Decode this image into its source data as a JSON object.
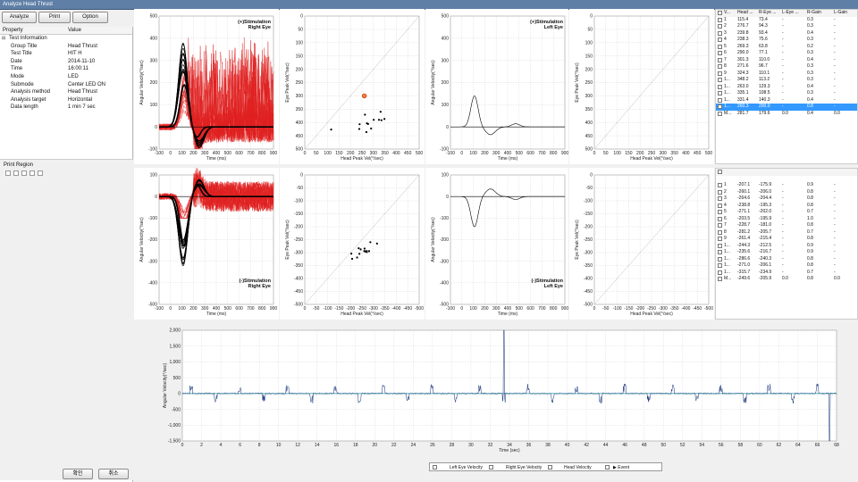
{
  "window": {
    "title": "Analyze Head Thrust"
  },
  "toolbar": {
    "analyze": "Analyze",
    "print": "Print",
    "option": "Option"
  },
  "properties": {
    "col_property": "Property",
    "col_value": "Value",
    "group_label": "Test Information",
    "group_toggle": "⊟",
    "rows": [
      {
        "name": "Group Title",
        "value": "Head Thrust"
      },
      {
        "name": "Test Title",
        "value": "HIT H"
      },
      {
        "name": "Date",
        "value": "2014-11-10"
      },
      {
        "name": "Time",
        "value": "16:00:11"
      },
      {
        "name": "Mode",
        "value": "LED"
      },
      {
        "name": "Submode",
        "value": "Center LED ON"
      },
      {
        "name": "Analysis method",
        "value": "Head Thrust"
      },
      {
        "name": "Analysis target",
        "value": "Horizontal"
      },
      {
        "name": "Data length",
        "value": "1 min 7 sec"
      }
    ]
  },
  "print_region": {
    "label": "Print Region"
  },
  "buttons": {
    "ok": "확인",
    "cancel": "취소"
  },
  "labels": {
    "time_ms": "Time (ms)",
    "angular_velocity": "Angular Velocity(°/sec)",
    "eye_peak": "Eye Peak Vel(°/sec)",
    "head_peak": "Head Peak Vel(°/sec)",
    "time_sec": "Time (sec)"
  },
  "titles": {
    "pos_right_1": "(+)Stimulation",
    "pos_right_2": "Right Eye",
    "pos_left_1": "(+)Stimulation",
    "pos_left_2": "Left Eye",
    "neg_right_1": "(-)Stimulation",
    "neg_right_2": "Right Eye",
    "neg_left_1": "(-)Stimulation",
    "neg_left_2": "Left Eye"
  },
  "ticks": {
    "time_x": [
      "-100",
      "0",
      "100",
      "200",
      "300",
      "400",
      "500",
      "600",
      "700",
      "800",
      "900"
    ],
    "vel_pos_y": [
      "500",
      "400",
      "300",
      "200",
      "100",
      "0",
      "-100"
    ],
    "vel_neg_y": [
      "100",
      "0",
      "-100",
      "-200",
      "-300",
      "-400",
      "-500"
    ],
    "peak_pos": [
      "0",
      "50",
      "100",
      "150",
      "200",
      "250",
      "300",
      "350",
      "400",
      "450",
      "500"
    ],
    "peak_neg": [
      "0",
      "-50",
      "-100",
      "-150",
      "-200",
      "-250",
      "-300",
      "-350",
      "-400",
      "-450",
      "-500"
    ],
    "bottom_y": [
      "2,000",
      "1,500",
      "1,000",
      "500",
      "0",
      "-500",
      "-1,000",
      "-1,500"
    ],
    "bottom_x": [
      "0",
      "2",
      "4",
      "6",
      "8",
      "10",
      "12",
      "14",
      "16",
      "18",
      "20",
      "22",
      "24",
      "26",
      "28",
      "30",
      "32",
      "34",
      "36",
      "38",
      "40",
      "42",
      "44",
      "46",
      "48",
      "50",
      "52",
      "54",
      "56",
      "58",
      "60",
      "62",
      "64",
      "66",
      "68"
    ]
  },
  "table_top": {
    "headers": [
      "V...",
      "Head ...",
      "R-Eye ...",
      "L-Eye ...",
      "R-Gain",
      "L-Gain"
    ],
    "rows": [
      [
        "1",
        "115.4",
        "73.4",
        "-",
        "0.3",
        "-"
      ],
      [
        "2",
        "276.7",
        "94.3",
        "-",
        "0.3",
        "-"
      ],
      [
        "3",
        "239.8",
        "93.4",
        "-",
        "0.4",
        "-"
      ],
      [
        "4",
        "238.3",
        "75.6",
        "-",
        "0.3",
        "-"
      ],
      [
        "5",
        "269.3",
        "63.8",
        "-",
        "0.2",
        "-"
      ],
      [
        "6",
        "290.0",
        "77.1",
        "-",
        "0.3",
        "-"
      ],
      [
        "7",
        "301.3",
        "110.0",
        "-",
        "0.4",
        "-"
      ],
      [
        "8",
        "271.6",
        "96.7",
        "-",
        "0.3",
        "-"
      ],
      [
        "9",
        "324.3",
        "110.1",
        "-",
        "0.3",
        "-"
      ],
      [
        "1...",
        "348.2",
        "113.2",
        "-",
        "0.3",
        "-"
      ],
      [
        "1...",
        "263.0",
        "129.3",
        "-",
        "0.4",
        "-"
      ],
      [
        "1...",
        "335.1",
        "108.5",
        "-",
        "0.3",
        "-"
      ],
      [
        "1...",
        "331.4",
        "140.3",
        "-",
        "0.4",
        "-"
      ],
      [
        "1...",
        "260.3",
        "200.0",
        "-",
        "0.8",
        "-"
      ],
      [
        "M...",
        "281.7",
        "179.6",
        "0.0",
        "0.4",
        "0.0"
      ]
    ],
    "selected_row": 13
  },
  "table_bottom": {
    "rows": [
      [
        "1",
        "-207.1",
        "-175.9",
        "-",
        "0.9",
        "-"
      ],
      [
        "2",
        "-260.1",
        "-206.0",
        "-",
        "0.8",
        "-"
      ],
      [
        "3",
        "-264.6",
        "-204.4",
        "-",
        "0.8",
        "-"
      ],
      [
        "4",
        "-238.8",
        "-195.3",
        "-",
        "0.8",
        "-"
      ],
      [
        "5",
        "-271.1",
        "-202.0",
        "-",
        "0.7",
        "-"
      ],
      [
        "6",
        "-203.5",
        "-195.9",
        "-",
        "1.0",
        "-"
      ],
      [
        "7",
        "-228.7",
        "-181.0",
        "-",
        "0.8",
        "-"
      ],
      [
        "8",
        "-281.2",
        "-205.7",
        "-",
        "0.7",
        "-"
      ],
      [
        "9",
        "-261.4",
        "-215.4",
        "-",
        "0.8",
        "-"
      ],
      [
        "1...",
        "-244.3",
        "-212.5",
        "-",
        "0.9",
        "-"
      ],
      [
        "1...",
        "-235.6",
        "-216.7",
        "-",
        "0.9",
        "-"
      ],
      [
        "1...",
        "-286.6",
        "-240.3",
        "-",
        "0.8",
        "-"
      ],
      [
        "1...",
        "-271.0",
        "-206.1",
        "-",
        "0.8",
        "-"
      ],
      [
        "1...",
        "-315.7",
        "-234.9",
        "-",
        "0.7",
        "-"
      ],
      [
        "M...",
        "-249.6",
        "-205.9",
        "0.0",
        "0.8",
        "0.0"
      ]
    ]
  },
  "legend": {
    "left_eye": "Left Eye Velocity",
    "right_eye": "Right Eye Velocity",
    "head": "Head Velocity",
    "event": "▶ Event"
  },
  "chart_data": [
    {
      "type": "scatter",
      "name": "peak-pos",
      "x": [
        115.4,
        276.7,
        239.8,
        238.3,
        269.3,
        290.0,
        301.3,
        271.6,
        324.3,
        348.2,
        263.0,
        335.1,
        331.4,
        260.3
      ],
      "y": [
        73.4,
        94.3,
        93.4,
        75.6,
        63.8,
        77.1,
        110.0,
        96.7,
        110.1,
        113.2,
        129.3,
        108.5,
        140.3,
        200.0
      ],
      "highlight": 13,
      "xlim": [
        0,
        500
      ],
      "ylim": [
        0,
        500
      ]
    },
    {
      "type": "scatter",
      "name": "peak-neg",
      "x": [
        -207.1,
        -260.1,
        -264.6,
        -238.8,
        -271.1,
        -203.5,
        -228.7,
        -281.2,
        -261.4,
        -244.3,
        -235.6,
        -286.6,
        -271.0,
        -315.7
      ],
      "y": [
        -175.9,
        -206.0,
        -204.4,
        -195.3,
        -202.0,
        -195.9,
        -181.0,
        -205.7,
        -215.4,
        -212.5,
        -216.7,
        -240.3,
        -206.1,
        -234.9
      ],
      "xlim": [
        0,
        -500
      ],
      "ylim": [
        0,
        -500
      ]
    }
  ],
  "colors": {
    "head": "#000000",
    "right_eye": "#e02020",
    "mean": "#000000",
    "baseline": "#1a9a9a",
    "eye_trace": "#10307a"
  }
}
